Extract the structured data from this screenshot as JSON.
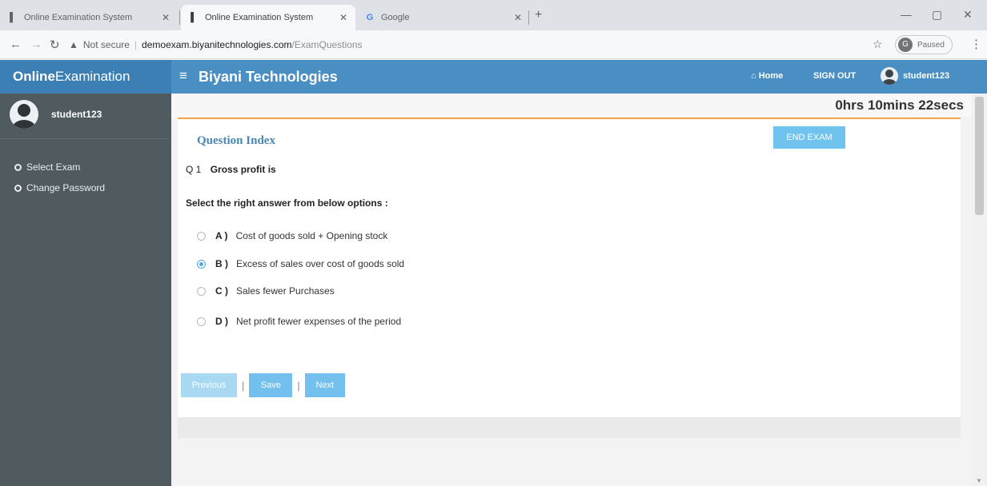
{
  "browser": {
    "tabs": [
      {
        "title": "Online Examination System",
        "active": false
      },
      {
        "title": "Online Examination System",
        "active": true
      },
      {
        "title": "Google",
        "active": false
      }
    ],
    "not_secure": "Not secure",
    "url_host": "demoexam.biyanitechnologies.com",
    "url_path": "/ExamQuestions",
    "profile_status": "Paused",
    "profile_initial": "G"
  },
  "header": {
    "brand_bold": "Online",
    "brand_rest": "Examination",
    "company": "Biyani Technologies",
    "home": "Home",
    "signout": "SIGN OUT",
    "username": "student123"
  },
  "sidebar": {
    "username": "student123",
    "items": [
      {
        "label": "Select Exam"
      },
      {
        "label": "Change Password"
      }
    ]
  },
  "exam": {
    "timer": "0hrs 10mins 22secs",
    "question_index": "Question Index",
    "end_exam": "END EXAM",
    "question_no": "Q 1",
    "question_text": "Gross profit is",
    "instruction": "Select the right answer from below options :",
    "options": [
      {
        "label": "A )",
        "text": "Cost of goods sold + Opening stock",
        "selected": false
      },
      {
        "label": "B )",
        "text": "Excess of sales over cost of goods sold",
        "selected": true
      },
      {
        "label": "C )",
        "text": "Sales fewer Purchases",
        "selected": false
      },
      {
        "label": "D )",
        "text": "Net profit fewer expenses of the period",
        "selected": false
      }
    ],
    "buttons": {
      "previous": "Previous",
      "save": "Save",
      "next": "Next"
    }
  },
  "colors": {
    "header": "#4a8fc4",
    "sidebar": "#505b60",
    "accent_button": "#73c0ee",
    "timer_line": "#f0a54a"
  }
}
